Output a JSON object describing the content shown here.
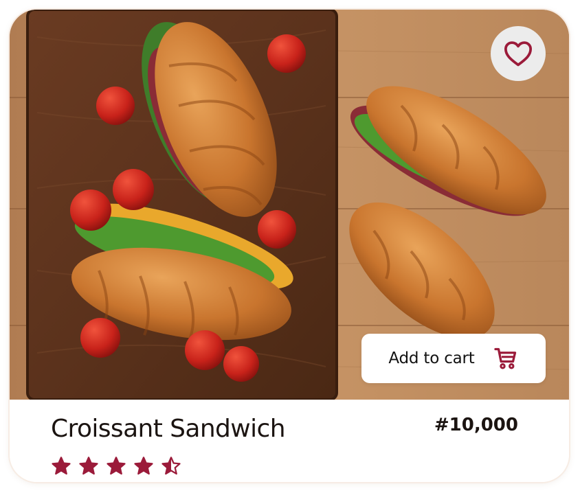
{
  "product": {
    "name": "Croissant Sandwich",
    "price": "#10,000",
    "rating": 4.5,
    "rating_max": 5
  },
  "actions": {
    "add_to_cart_label": "Add to cart",
    "favorite_icon": "heart-icon",
    "cart_icon": "shopping-cart-icon"
  },
  "colors": {
    "accent": "#9b1b3a",
    "favorite_bg": "#ececec",
    "text": "#1b1411",
    "card_bg": "#ffffff"
  }
}
